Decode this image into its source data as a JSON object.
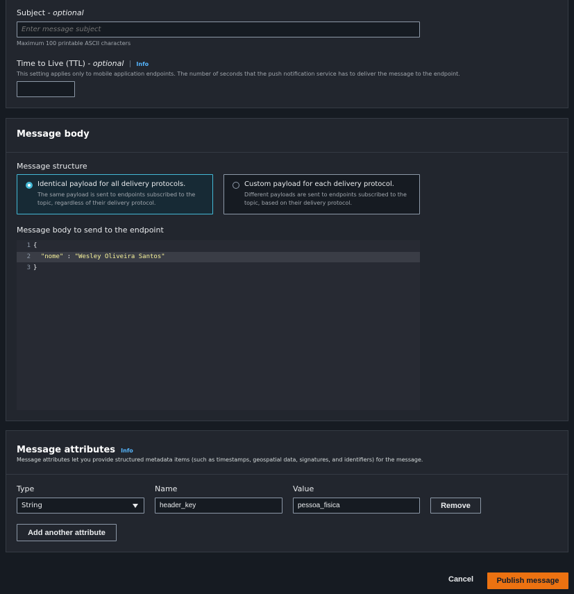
{
  "subject": {
    "label": "Subject",
    "optional": "- optional",
    "placeholder": "Enter message subject",
    "hint": "Maximum 100 printable ASCII characters"
  },
  "ttl": {
    "label": "Time to Live (TTL)",
    "optional": "- optional",
    "info": "Info",
    "description": "This setting applies only to mobile application endpoints. The number of seconds that the push notification service has to deliver the message to the endpoint.",
    "value": ""
  },
  "message_body": {
    "title": "Message body",
    "structure_label": "Message structure",
    "options": [
      {
        "title": "Identical payload for all delivery protocols.",
        "desc_line1": "The same payload is sent to endpoints subscribed to the",
        "desc_line2": "topic, regardless of their delivery protocol.",
        "selected": true
      },
      {
        "title": "Custom payload for each delivery protocol.",
        "desc_line1": "Different payloads are sent to endpoints subscribed to the",
        "desc_line2": "topic, based on their delivery protocol.",
        "selected": false
      }
    ],
    "editor_label": "Message body to send to the endpoint",
    "code": {
      "line1_num": "1",
      "line1": "{",
      "line2_num": "2",
      "line2_key": "\"nome\"",
      "line2_sep": " : ",
      "line2_val": "\"Wesley Oliveira Santos\"",
      "line3_num": "3",
      "line3": "}"
    }
  },
  "attributes": {
    "title": "Message attributes",
    "info": "Info",
    "description": "Message attributes let you provide structured metadata items (such as timestamps, geospatial data, signatures, and identifiers) for the message.",
    "type_label": "Type",
    "name_label": "Name",
    "value_label": "Value",
    "type_value": "String",
    "name_value": "header_key",
    "value_value": "pessoa_fisica",
    "remove_label": "Remove",
    "add_label": "Add another attribute"
  },
  "footer": {
    "cancel_label": "Cancel",
    "publish_label": "Publish message"
  },
  "colors": {
    "accent": "#44b9d6",
    "primary_button": "#ec7211",
    "background": "#161b22",
    "panel": "#22262e"
  }
}
